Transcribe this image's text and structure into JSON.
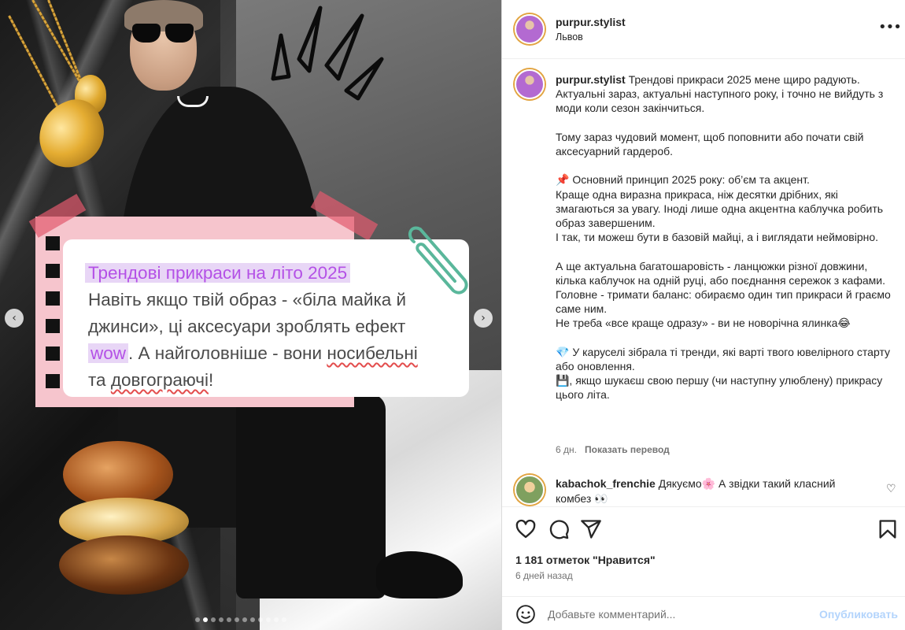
{
  "media": {
    "card": {
      "title": "Трендові прикраси на літо 2025",
      "line1": "Навіть якщо твій образ - «біла майка й",
      "line2": "джинси», ці аксесуари зроблять ефект",
      "wow": "wow",
      "line3_rest": ". А найголовніше - вони ",
      "word_nosibelni": "носибельні",
      "line4_pre": "та ",
      "word_dovgograiuchi": "довгограючі",
      "line4_post": "!"
    },
    "nav": {
      "prev": "‹",
      "next": "›"
    },
    "dots_count": 12,
    "active_dot": 1
  },
  "post": {
    "header": {
      "username": "purpur.stylist",
      "location": "Львов",
      "more": "•••"
    },
    "caption": {
      "username": "purpur.stylist",
      "text": "Трендові прикраси 2025 мене щиро радують. Актуальні зараз, актуальні наступного року, і точно не вийдуть з моди коли сезон закінчиться.\n\nТому зараз чудовий момент, щоб поповнити або почати свій аксесуарний гардероб.\n\n📌 Основний принцип 2025 року: об’єм та акцент.\nКраще одна виразна прикраса, ніж десятки дрібних, які змагаються за увагу. Іноді лише одна акцентна каблучка робить образ завершеним.\nІ так, ти можеш бути в базовій майці, а і виглядати неймовірно.\n\nА ще актуальна багатошаровість - ланцюжки різної довжини, кілька каблучок на одній руці, або поєднання сережок з кафами.\nГоловне - тримати баланс: обираємо один тип прикраси й граємо саме ним.\nНе треба «все краще одразу» - ви не новорічна ялинка😂\n\n💎 У каруселі зібрала ті тренди, які варті твого ювелірного старту або оновлення.\n💾, якщо шукаєш свою першу (чи наступну улюблену) прикрасу цього літа.",
      "age": "6 дн.",
      "translate": "Показать перевод"
    },
    "comment": {
      "username": "kabachok_frenchie",
      "text": " Дякуємо🌸  А звідки такий класний комбез 👀"
    },
    "likes": "1 181 отметок \"Нравится\"",
    "date": "6 дней назад",
    "add_comment": {
      "placeholder": "Добавьте комментарий...",
      "publish": "Опубликовать"
    }
  }
}
